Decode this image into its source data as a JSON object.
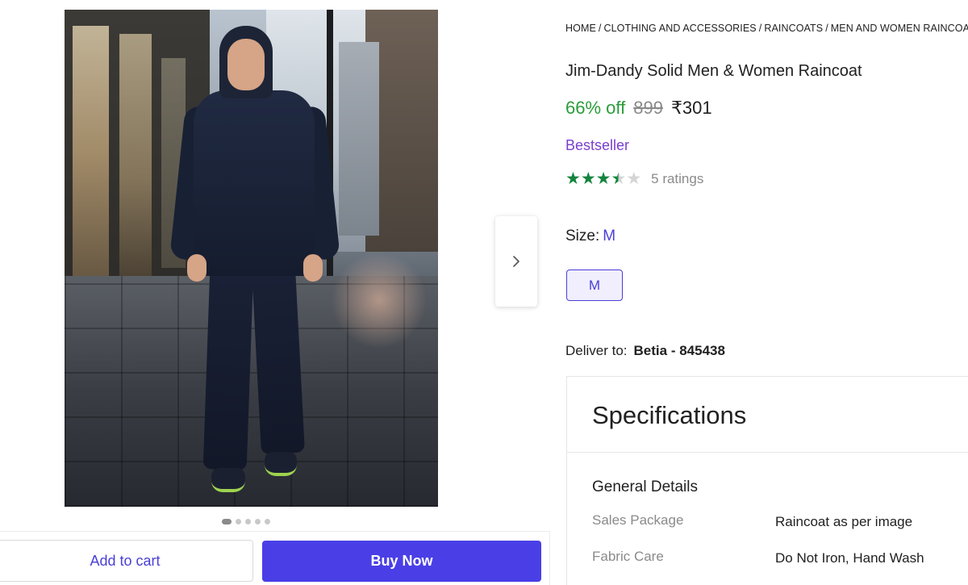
{
  "gallery": {
    "image_alt": "Man walking on wet city sidewalk wearing a navy hooded raincoat and pants",
    "dots_total": 5,
    "active_dot": 1,
    "next_icon": "chevron-right-icon"
  },
  "breadcrumb": [
    "HOME",
    "CLOTHING AND ACCESSORIES",
    "RAINCOATS",
    "MEN AND WOMEN RAINCOATS"
  ],
  "product": {
    "title": "Jim-Dandy Solid Men & Women Raincoat",
    "discount": "66% off",
    "mrp": "899",
    "price": "₹301",
    "badge": "Bestseller",
    "rating_value": 3.5,
    "ratings_text": "5 ratings"
  },
  "size": {
    "label": "Size:",
    "selected": "M",
    "options": [
      "M"
    ]
  },
  "delivery": {
    "label": "Deliver to:",
    "location": "Betia - 845438"
  },
  "specifications": {
    "title": "Specifications",
    "group": "General Details",
    "rows": [
      {
        "key": "Sales Package",
        "value": "Raincoat as per image"
      },
      {
        "key": "Fabric Care",
        "value": "Do Not Iron, Hand Wash"
      }
    ]
  },
  "actions": {
    "add_to_cart": "Add to cart",
    "buy_now": "Buy Now"
  },
  "colors": {
    "accent": "#4a3fe6",
    "discount_green": "#2a9d3a",
    "star_green": "#14853d",
    "bestseller_purple": "#7b3fcf"
  }
}
